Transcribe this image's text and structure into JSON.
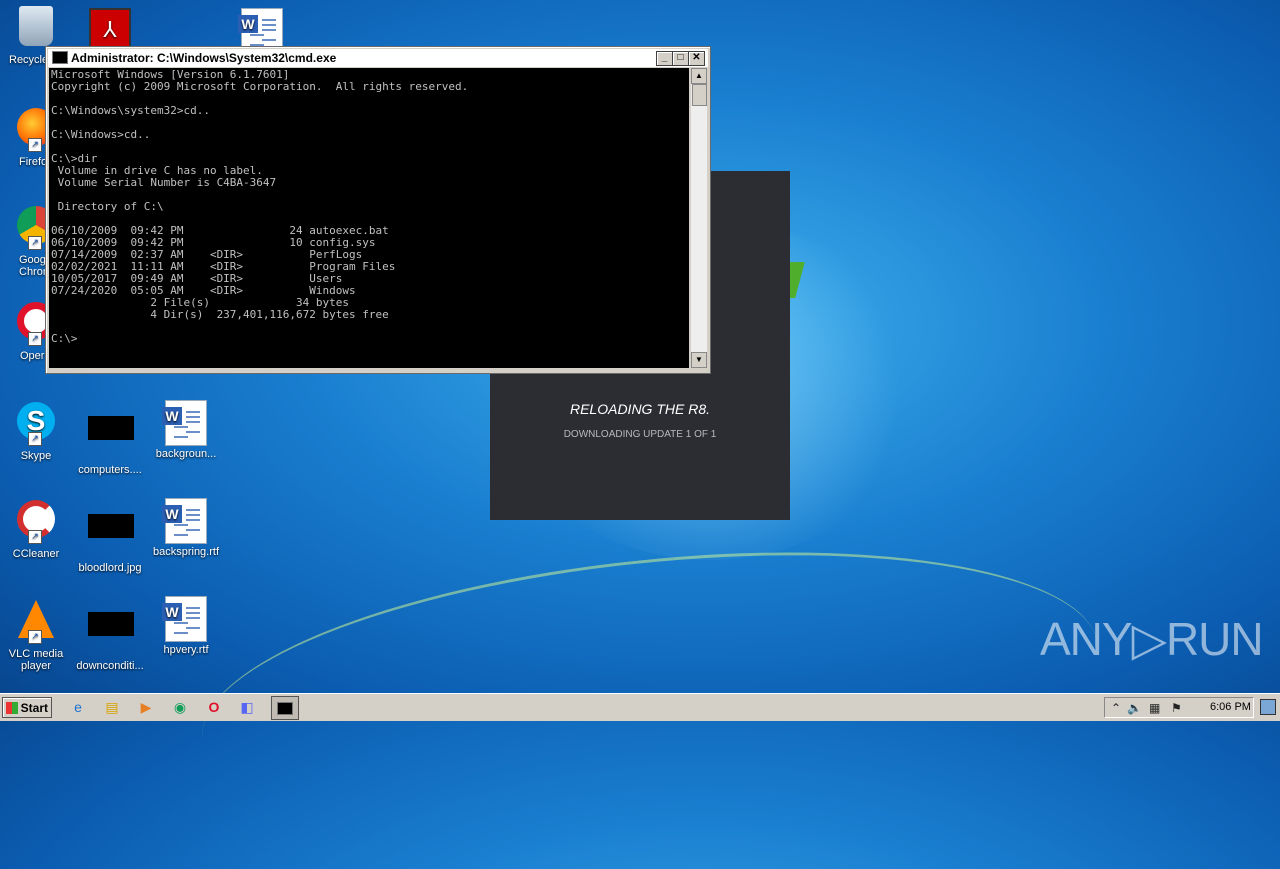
{
  "desktop": {
    "icons": [
      {
        "label": "Recycle",
        "icon": "recycle-bin-icon"
      },
      {
        "label": "Firefo",
        "icon": "firefox-icon"
      },
      {
        "label": "Goog\nChrom",
        "icon": "chrome-icon"
      },
      {
        "label": "Oper",
        "icon": "opera-icon"
      },
      {
        "label": "Skype",
        "icon": "skype-icon"
      },
      {
        "label": "CCleaner",
        "icon": "ccleaner-icon"
      },
      {
        "label": "VLC media\nplayer",
        "icon": "vlc-icon"
      },
      {
        "label": "computers....",
        "icon": "image-file-icon"
      },
      {
        "label": "bloodlord.jpg",
        "icon": "image-file-icon"
      },
      {
        "label": "downconditi...",
        "icon": "image-file-icon"
      },
      {
        "label": "backgroun...",
        "icon": "word-doc-icon"
      },
      {
        "label": "backspring.rtf",
        "icon": "word-doc-icon"
      },
      {
        "label": "hpvery.rtf",
        "icon": "word-doc-icon"
      }
    ]
  },
  "cmd": {
    "title": "Administrator: C:\\Windows\\System32\\cmd.exe",
    "minimize": "_",
    "maximize": "□",
    "close": "✕",
    "output": "Microsoft Windows [Version 6.1.7601]\nCopyright (c) 2009 Microsoft Corporation.  All rights reserved.\n\nC:\\Windows\\system32>cd..\n\nC:\\Windows>cd..\n\nC:\\>dir\n Volume in drive C has no label.\n Volume Serial Number is C4BA-3647\n\n Directory of C:\\\n\n06/10/2009  09:42 PM                24 autoexec.bat\n06/10/2009  09:42 PM                10 config.sys\n07/14/2009  02:37 AM    <DIR>          PerfLogs\n02/02/2021  11:11 AM    <DIR>          Program Files\n10/05/2017  09:49 AM    <DIR>          Users\n07/24/2020  05:05 AM    <DIR>          Windows\n               2 File(s)             34 bytes\n               4 Dir(s)  237,401,116,672 bytes free\n\nC:\\>"
  },
  "overlay": {
    "title": "RELOADING THE R8.",
    "subtitle": "DOWNLOADING UPDATE 1 OF 1"
  },
  "watermark": "ANY▷RUN",
  "taskbar": {
    "start_label": "Start",
    "pinned": [
      "ie-icon",
      "explorer-icon",
      "media-player-icon",
      "chrome-icon",
      "opera-icon",
      "discord-icon"
    ],
    "clock": "6:06 PM"
  }
}
